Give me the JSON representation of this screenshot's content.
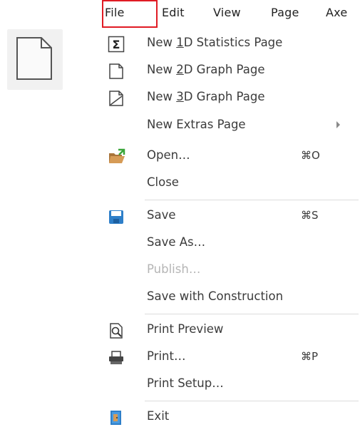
{
  "menubar": {
    "items": [
      {
        "label": "File",
        "mnemonic": "F"
      },
      {
        "label": "Edit",
        "mnemonic": "E"
      },
      {
        "label": "View",
        "mnemonic": "V"
      },
      {
        "label": "Page",
        "mnemonic": "P"
      },
      {
        "label": "Axe",
        "mnemonic": "A"
      }
    ]
  },
  "menu": {
    "items": [
      {
        "label_pre": "New ",
        "label_mn": "1",
        "label_post": "D Statistics Page",
        "icon": "sigma-icon"
      },
      {
        "label_pre": "New ",
        "label_mn": "2",
        "label_post": "D Graph Page",
        "icon": "page-2d-icon"
      },
      {
        "label_pre": "New ",
        "label_mn": "3",
        "label_post": "D Graph Page",
        "icon": "page-3d-icon"
      },
      {
        "label": "New Extras Page",
        "icon": "",
        "submenu": true
      },
      {
        "label": "Open…",
        "shortcut": "⌘O",
        "icon": "open-folder-icon"
      },
      {
        "label": "Close",
        "icon": ""
      },
      {
        "label": "Save",
        "shortcut": "⌘S",
        "icon": "save-disk-icon"
      },
      {
        "label": "Save As…",
        "icon": ""
      },
      {
        "label": "Publish…",
        "icon": "",
        "disabled": true
      },
      {
        "label": "Save with Construction",
        "icon": ""
      },
      {
        "label": "Print Preview",
        "icon": "print-preview-icon"
      },
      {
        "label": "Print…",
        "shortcut": "⌘P",
        "icon": "printer-icon"
      },
      {
        "label": "Print Setup…",
        "icon": ""
      },
      {
        "label": "Exit",
        "icon": "exit-door-icon"
      }
    ]
  },
  "colors": {
    "highlight": "#e01b24",
    "accent": "#2e7fc9",
    "folder": "#c8904a"
  }
}
